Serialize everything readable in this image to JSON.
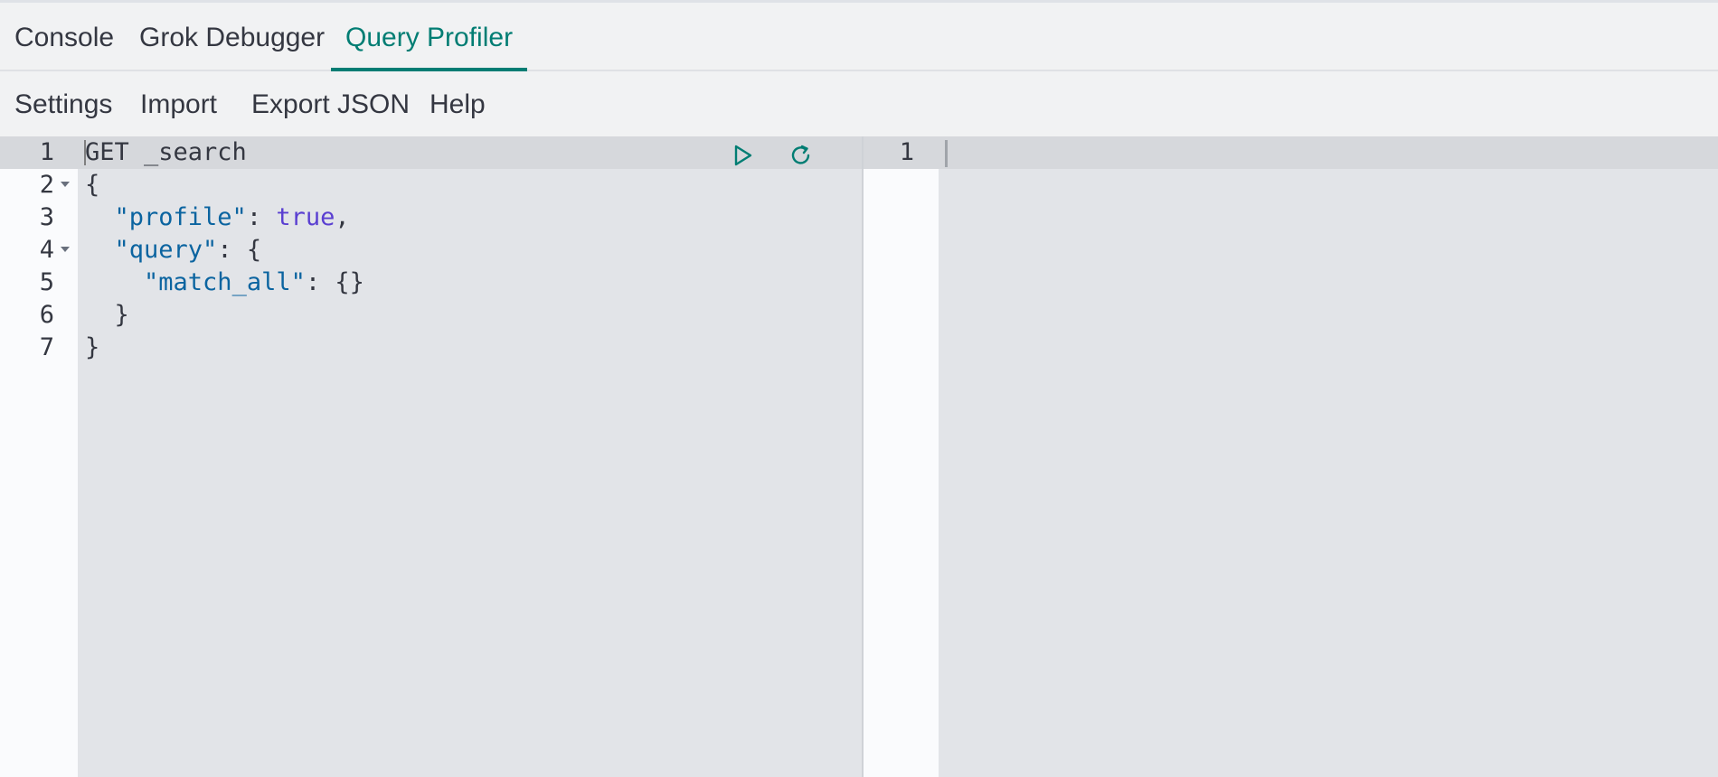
{
  "tabs": [
    {
      "label": "Console"
    },
    {
      "label": "Grok Debugger"
    },
    {
      "label": "Query Profiler",
      "active": true
    }
  ],
  "menu": {
    "settings": "Settings",
    "import": "Import",
    "export_json": "Export JSON",
    "help": "Help"
  },
  "editor": {
    "lines": [
      {
        "number": "1",
        "text": "GET _search"
      },
      {
        "number": "2",
        "text": "{",
        "foldable": true
      },
      {
        "number": "3",
        "key": "\"profile\"",
        "sep": ": ",
        "value": "true",
        "tail": ","
      },
      {
        "number": "4",
        "key": "\"query\"",
        "sep": ": {",
        "foldable": true
      },
      {
        "number": "5",
        "key": "\"match_all\"",
        "sep": ": {}"
      },
      {
        "number": "6",
        "text": "  }"
      },
      {
        "number": "7",
        "text": "}"
      }
    ],
    "run_icon": "play-icon",
    "reload_icon": "refresh-icon"
  },
  "output": {
    "lines": [
      {
        "number": "1",
        "text": ""
      }
    ]
  },
  "colors": {
    "accent": "#017d73",
    "string": "#0b64a0",
    "keyword": "#5a3fd1"
  }
}
